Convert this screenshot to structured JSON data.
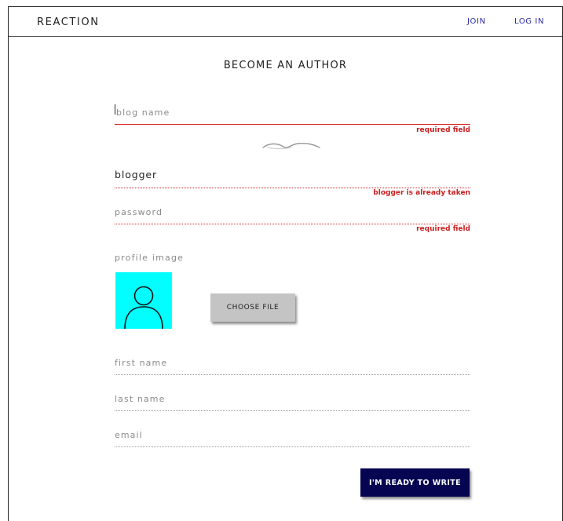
{
  "header": {
    "brand": "REACTION",
    "nav": {
      "join": "JOIN",
      "login": "LOG IN"
    }
  },
  "page_title": "BECOME AN AUTHOR",
  "form": {
    "blog_name": {
      "placeholder": "blog name",
      "value": "",
      "error": "required field"
    },
    "username": {
      "value": "blogger",
      "error": "blogger is already taken"
    },
    "password": {
      "placeholder": "password",
      "value": "",
      "error": "required field"
    },
    "profile_image": {
      "label": "profile image",
      "choose_button": "CHOOSE FILE"
    },
    "first_name": {
      "placeholder": "first name",
      "value": ""
    },
    "last_name": {
      "placeholder": "last name",
      "value": ""
    },
    "email": {
      "placeholder": "email",
      "value": ""
    },
    "submit": "I'M READY TO WRITE"
  },
  "colors": {
    "error": "#c81e1e",
    "nav_link": "#2a2aa0",
    "submit_bg": "#050552",
    "avatar_bg": "#00ffff",
    "choose_bg": "#c4c4c4"
  },
  "icons": {
    "loading": "loading-spinner-icon",
    "avatar": "user-avatar-icon"
  }
}
